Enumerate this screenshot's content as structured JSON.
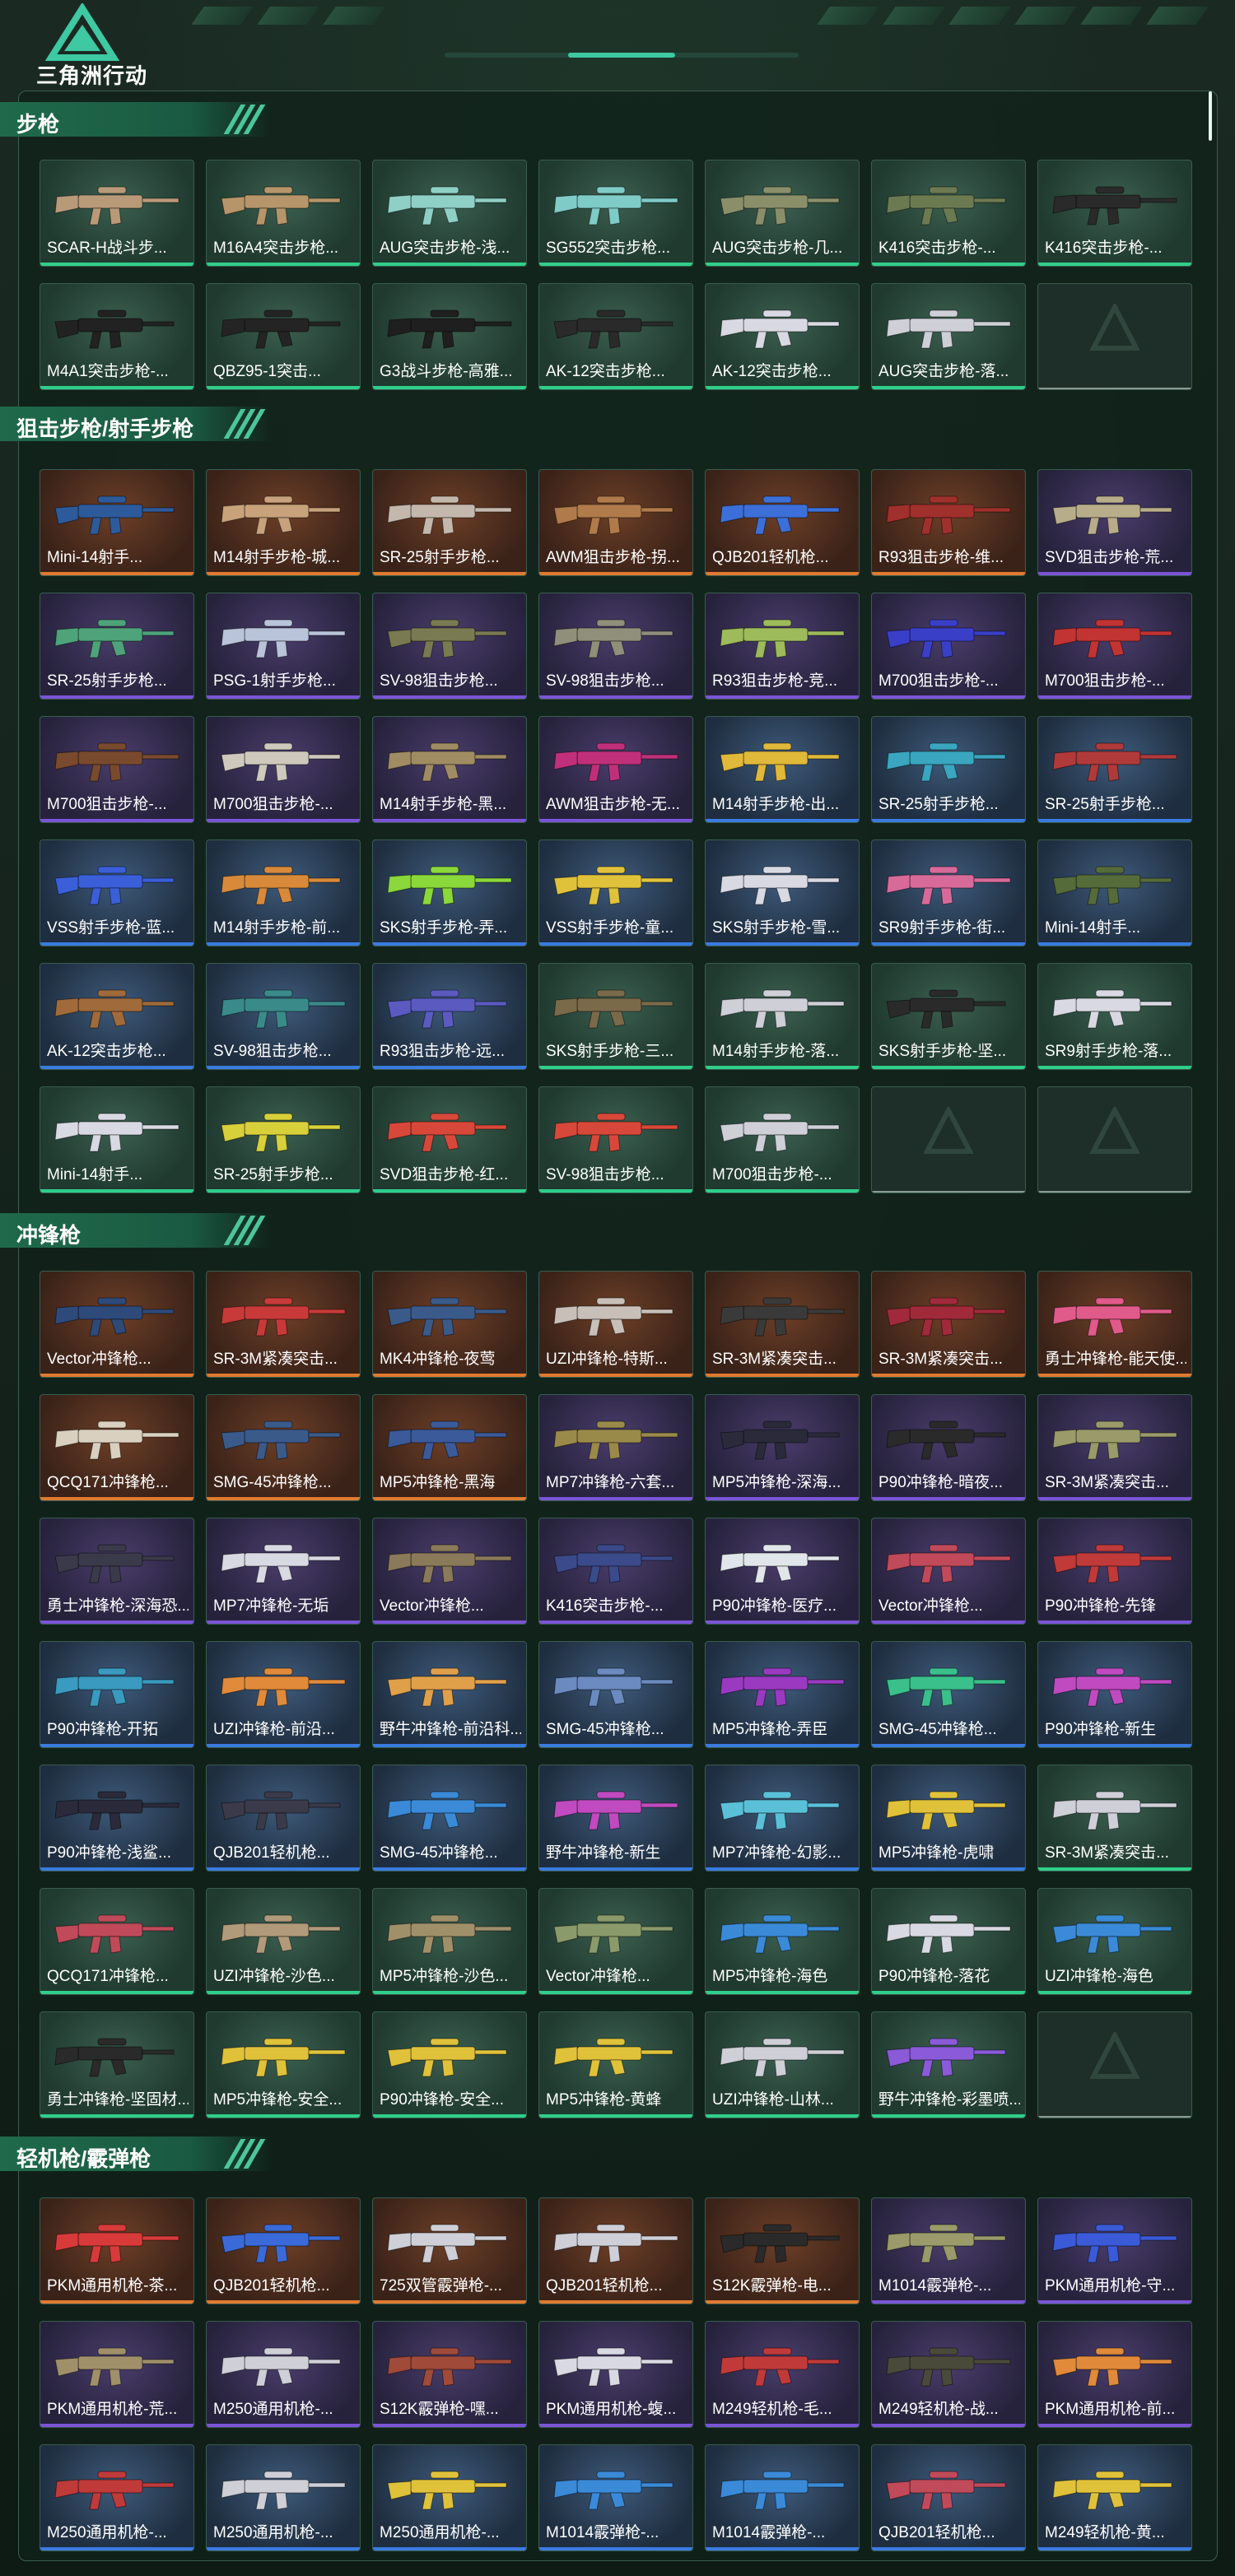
{
  "game": {
    "title": "三角洲行动"
  },
  "colors": {
    "green": "#2fcf8a",
    "purple": "#7b54d6",
    "orange": "#e07a30",
    "blue": "#3a7be0"
  },
  "sections": [
    {
      "title": "步枪",
      "items": [
        {
          "name": "SCAR-H战斗步...",
          "rarity": "green",
          "color": "#b99a78"
        },
        {
          "name": "M16A4突击步枪...",
          "rarity": "green",
          "color": "#b6956a"
        },
        {
          "name": "AUG突击步枪-浅...",
          "rarity": "green",
          "color": "#8fd0c6"
        },
        {
          "name": "SG552突击步枪...",
          "rarity": "green",
          "color": "#7fcbc7"
        },
        {
          "name": "AUG突击步枪-几...",
          "rarity": "green",
          "color": "#8a8f6a"
        },
        {
          "name": "K416突击步枪-...",
          "rarity": "green",
          "color": "#6c7a52"
        },
        {
          "name": "K416突击步枪-...",
          "rarity": "green",
          "color": "#2a2a2a"
        },
        {
          "name": "M4A1突击步枪-...",
          "rarity": "green",
          "color": "#222222"
        },
        {
          "name": "QBZ95-1突击...",
          "rarity": "green",
          "color": "#242424"
        },
        {
          "name": "G3战斗步枪-高雅...",
          "rarity": "green",
          "color": "#1f1f1f"
        },
        {
          "name": "AK-12突击步枪...",
          "rarity": "green",
          "color": "#2a2a2a"
        },
        {
          "name": "AK-12突击步枪...",
          "rarity": "green",
          "color": "#d9d9e3"
        },
        {
          "name": "AUG突击步枪-落...",
          "rarity": "green",
          "color": "#cfcfd8"
        },
        {
          "name": "",
          "rarity": "empty",
          "color": ""
        }
      ]
    },
    {
      "title": "狙击步枪/射手步枪",
      "items": [
        {
          "name": "Mini-14射手...",
          "rarity": "orange",
          "color": "#2d5a9a"
        },
        {
          "name": "M14射手步枪-城...",
          "rarity": "orange",
          "color": "#c7a27b"
        },
        {
          "name": "SR-25射手步枪...",
          "rarity": "orange",
          "color": "#c4b8ad"
        },
        {
          "name": "AWM狙击步枪-拐...",
          "rarity": "orange",
          "color": "#b07a4a"
        },
        {
          "name": "QJB201轻机枪...",
          "rarity": "orange",
          "color": "#3c6fd8"
        },
        {
          "name": "R93狙击步枪-维...",
          "rarity": "orange",
          "color": "#a0302c"
        },
        {
          "name": "SVD狙击步枪-荒...",
          "rarity": "purple",
          "color": "#b8ad8a"
        },
        {
          "name": "SR-25射手步枪...",
          "rarity": "purple",
          "color": "#4ea37a"
        },
        {
          "name": "PSG-1射手步枪...",
          "rarity": "purple",
          "color": "#b9c3d9"
        },
        {
          "name": "SV-98狙击步枪...",
          "rarity": "purple",
          "color": "#7a7a52"
        },
        {
          "name": "SV-98狙击步枪...",
          "rarity": "purple",
          "color": "#8f8f7a"
        },
        {
          "name": "R93狙击步枪-竞...",
          "rarity": "purple",
          "color": "#9dbb5a"
        },
        {
          "name": "M700狙击步枪-...",
          "rarity": "purple",
          "color": "#3a3fc8"
        },
        {
          "name": "M700狙击步枪-...",
          "rarity": "purple",
          "color": "#c23333"
        },
        {
          "name": "M700狙击步枪-...",
          "rarity": "purple",
          "color": "#7a4a2e"
        },
        {
          "name": "M700狙击步枪-...",
          "rarity": "purple",
          "color": "#cfc9bd"
        },
        {
          "name": "M14射手步枪-黑...",
          "rarity": "purple",
          "color": "#a08c62"
        },
        {
          "name": "AWM狙击步枪-无...",
          "rarity": "purple",
          "color": "#c0307a"
        },
        {
          "name": "M14射手步枪-出...",
          "rarity": "blue",
          "color": "#e0b83a"
        },
        {
          "name": "SR-25射手步枪...",
          "rarity": "blue",
          "color": "#3aa6c0"
        },
        {
          "name": "SR-25射手步枪...",
          "rarity": "blue",
          "color": "#b03a3a"
        },
        {
          "name": "VSS射手步枪-蓝...",
          "rarity": "blue",
          "color": "#3a5fd8"
        },
        {
          "name": "M14射手步枪-前...",
          "rarity": "blue",
          "color": "#d88a3a"
        },
        {
          "name": "SKS射手步枪-弄...",
          "rarity": "blue",
          "color": "#8ad83a"
        },
        {
          "name": "VSS射手步枪-童...",
          "rarity": "blue",
          "color": "#e0c23a"
        },
        {
          "name": "SKS射手步枪-雪...",
          "rarity": "blue",
          "color": "#d9d9e3"
        },
        {
          "name": "SR9射手步枪-街...",
          "rarity": "blue",
          "color": "#d86a9a"
        },
        {
          "name": "Mini-14射手...",
          "rarity": "blue",
          "color": "#556b3a"
        },
        {
          "name": "AK-12突击步枪...",
          "rarity": "blue",
          "color": "#a06a3a"
        },
        {
          "name": "SV-98狙击步枪...",
          "rarity": "blue",
          "color": "#3a8a8a"
        },
        {
          "name": "R93狙击步枪-远...",
          "rarity": "blue",
          "color": "#5a5ac0"
        },
        {
          "name": "SKS射手步枪-三...",
          "rarity": "green",
          "color": "#7a6a4a"
        },
        {
          "name": "M14射手步枪-落...",
          "rarity": "green",
          "color": "#cfcfd8"
        },
        {
          "name": "SKS射手步枪-坚...",
          "rarity": "green",
          "color": "#2a2a2a"
        },
        {
          "name": "SR9射手步枪-落...",
          "rarity": "green",
          "color": "#d9d9e3"
        },
        {
          "name": "Mini-14射手...",
          "rarity": "green",
          "color": "#d9d9e3"
        },
        {
          "name": "SR-25射手步枪...",
          "rarity": "green",
          "color": "#d8d03a"
        },
        {
          "name": "SVD狙击步枪-红...",
          "rarity": "green",
          "color": "#d8483a"
        },
        {
          "name": "SV-98狙击步枪...",
          "rarity": "green",
          "color": "#d8483a"
        },
        {
          "name": "M700狙击步枪-...",
          "rarity": "green",
          "color": "#cfcfd8"
        },
        {
          "name": "",
          "rarity": "empty",
          "color": ""
        },
        {
          "name": "",
          "rarity": "empty",
          "color": ""
        }
      ]
    },
    {
      "title": "冲锋枪",
      "items": [
        {
          "name": "Vector冲锋枪...",
          "rarity": "orange",
          "color": "#2d4a7a"
        },
        {
          "name": "SR-3M紧凑突击...",
          "rarity": "orange",
          "color": "#c83a3a"
        },
        {
          "name": "MK4冲锋枪-夜莺",
          "rarity": "orange",
          "color": "#3a5a8a"
        },
        {
          "name": "UZI冲锋枪-特斯...",
          "rarity": "orange",
          "color": "#c8c0b8"
        },
        {
          "name": "SR-3M紧凑突击...",
          "rarity": "orange",
          "color": "#3a3a3a"
        },
        {
          "name": "SR-3M紧凑突击...",
          "rarity": "orange",
          "color": "#a02a3a"
        },
        {
          "name": "勇士冲锋枪-能天使...",
          "rarity": "orange",
          "color": "#e05a8a"
        },
        {
          "name": "QCQ171冲锋枪...",
          "rarity": "orange",
          "color": "#d9d0c0"
        },
        {
          "name": "SMG-45冲锋枪...",
          "rarity": "orange",
          "color": "#3a5a8a"
        },
        {
          "name": "MP5冲锋枪-黑海",
          "rarity": "orange",
          "color": "#3a5a9a"
        },
        {
          "name": "MP7冲锋枪-六套...",
          "rarity": "purple",
          "color": "#9a8a4a"
        },
        {
          "name": "MP5冲锋枪-深海...",
          "rarity": "purple",
          "color": "#2a2a3a"
        },
        {
          "name": "P90冲锋枪-暗夜...",
          "rarity": "purple",
          "color": "#2a2a2a"
        },
        {
          "name": "SR-3M紧凑突击...",
          "rarity": "purple",
          "color": "#9a9a6a"
        },
        {
          "name": "勇士冲锋枪-深海恐...",
          "rarity": "purple",
          "color": "#3a3a4a"
        },
        {
          "name": "MP7冲锋枪-无垢",
          "rarity": "purple",
          "color": "#d9d9e3"
        },
        {
          "name": "Vector冲锋枪...",
          "rarity": "purple",
          "color": "#8a7a5a"
        },
        {
          "name": "K416突击步枪-...",
          "rarity": "purple",
          "color": "#3a4a8a"
        },
        {
          "name": "P90冲锋枪-医疗...",
          "rarity": "purple",
          "color": "#e0e6ea"
        },
        {
          "name": "Vector冲锋枪...",
          "rarity": "purple",
          "color": "#c04a5a"
        },
        {
          "name": "P90冲锋枪-先锋",
          "rarity": "purple",
          "color": "#c03a3a"
        },
        {
          "name": "P90冲锋枪-开拓",
          "rarity": "blue",
          "color": "#3a9ac0"
        },
        {
          "name": "UZI冲锋枪-前沿...",
          "rarity": "blue",
          "color": "#e08a3a"
        },
        {
          "name": "野牛冲锋枪-前沿科...",
          "rarity": "blue",
          "color": "#e0a04a"
        },
        {
          "name": "SMG-45冲锋枪...",
          "rarity": "blue",
          "color": "#6a8ac0"
        },
        {
          "name": "MP5冲锋枪-弄臣",
          "rarity": "blue",
          "color": "#9a3ac0"
        },
        {
          "name": "SMG-45冲锋枪...",
          "rarity": "blue",
          "color": "#3ac08a"
        },
        {
          "name": "P90冲锋枪-新生",
          "rarity": "blue",
          "color": "#c04ac0"
        },
        {
          "name": "P90冲锋枪-浅鲨...",
          "rarity": "blue",
          "color": "#2a2a3a"
        },
        {
          "name": "QJB201轻机枪...",
          "rarity": "blue",
          "color": "#3a3a4a"
        },
        {
          "name": "SMG-45冲锋枪...",
          "rarity": "blue",
          "color": "#3a8ad8"
        },
        {
          "name": "野牛冲锋枪-新生",
          "rarity": "blue",
          "color": "#c04ac0"
        },
        {
          "name": "MP7冲锋枪-幻影...",
          "rarity": "blue",
          "color": "#5ac0d8"
        },
        {
          "name": "MP5冲锋枪-虎啸",
          "rarity": "blue",
          "color": "#e0c23a"
        },
        {
          "name": "SR-3M紧凑突击...",
          "rarity": "green",
          "color": "#cfcfd8"
        },
        {
          "name": "QCQ171冲锋枪...",
          "rarity": "green",
          "color": "#c04a5a"
        },
        {
          "name": "UZI冲锋枪-沙色...",
          "rarity": "green",
          "color": "#b09a7a"
        },
        {
          "name": "MP5冲锋枪-沙色...",
          "rarity": "green",
          "color": "#a0906a"
        },
        {
          "name": "Vector冲锋枪...",
          "rarity": "green",
          "color": "#8a9a6a"
        },
        {
          "name": "MP5冲锋枪-海色",
          "rarity": "green",
          "color": "#3a8ad8"
        },
        {
          "name": "P90冲锋枪-落花",
          "rarity": "green",
          "color": "#d9d9e3"
        },
        {
          "name": "UZI冲锋枪-海色",
          "rarity": "green",
          "color": "#3a8ad8"
        },
        {
          "name": "勇士冲锋枪-坚固材...",
          "rarity": "green",
          "color": "#2a2a2a"
        },
        {
          "name": "MP5冲锋枪-安全...",
          "rarity": "green",
          "color": "#e0c23a"
        },
        {
          "name": "P90冲锋枪-安全...",
          "rarity": "green",
          "color": "#e0c23a"
        },
        {
          "name": "MP5冲锋枪-黄蜂",
          "rarity": "green",
          "color": "#e0c23a"
        },
        {
          "name": "UZI冲锋枪-山林...",
          "rarity": "green",
          "color": "#cfcfd8"
        },
        {
          "name": "野牛冲锋枪-彩墨喷...",
          "rarity": "green",
          "color": "#8a5ad8"
        },
        {
          "name": "",
          "rarity": "empty",
          "color": ""
        }
      ]
    },
    {
      "title": "轻机枪/霰弹枪",
      "items": [
        {
          "name": "PKM通用机枪-茶...",
          "rarity": "orange",
          "color": "#d83a3a"
        },
        {
          "name": "QJB201轻机枪...",
          "rarity": "orange",
          "color": "#3a6ad8"
        },
        {
          "name": "725双管霰弹枪-...",
          "rarity": "orange",
          "color": "#cfcfd8"
        },
        {
          "name": "QJB201轻机枪...",
          "rarity": "orange",
          "color": "#cfcfd8"
        },
        {
          "name": "S12K霰弹枪-电...",
          "rarity": "orange",
          "color": "#2a2a2a"
        },
        {
          "name": "M1014霰弹枪-...",
          "rarity": "purple",
          "color": "#9a9a6a"
        },
        {
          "name": "PKM通用机枪-守...",
          "rarity": "purple",
          "color": "#3a5ad8"
        },
        {
          "name": "PKM通用机枪-荒...",
          "rarity": "purple",
          "color": "#a0906a"
        },
        {
          "name": "M250通用机枪-...",
          "rarity": "purple",
          "color": "#cfcfd8"
        },
        {
          "name": "S12K霰弹枪-嘿...",
          "rarity": "purple",
          "color": "#a04a3a"
        },
        {
          "name": "PKM通用机枪-蝮...",
          "rarity": "purple",
          "color": "#d9d9e3"
        },
        {
          "name": "M249轻机枪-毛...",
          "rarity": "purple",
          "color": "#c03a3a"
        },
        {
          "name": "M249轻机枪-战...",
          "rarity": "purple",
          "color": "#4a4a3a"
        },
        {
          "name": "PKM通用机枪-前...",
          "rarity": "purple",
          "color": "#e08a3a"
        },
        {
          "name": "M250通用机枪-...",
          "rarity": "blue",
          "color": "#c03a3a"
        },
        {
          "name": "M250通用机枪-...",
          "rarity": "blue",
          "color": "#cfcfd8"
        },
        {
          "name": "M250通用机枪-...",
          "rarity": "blue",
          "color": "#e0c23a"
        },
        {
          "name": "M1014霰弹枪-...",
          "rarity": "blue",
          "color": "#3a8ad8"
        },
        {
          "name": "M1014霰弹枪-...",
          "rarity": "blue",
          "color": "#3a8ad8"
        },
        {
          "name": "QJB201轻机枪...",
          "rarity": "blue",
          "color": "#c04a5a"
        },
        {
          "name": "M249轻机枪-黄...",
          "rarity": "blue",
          "color": "#e0c23a"
        }
      ]
    }
  ]
}
